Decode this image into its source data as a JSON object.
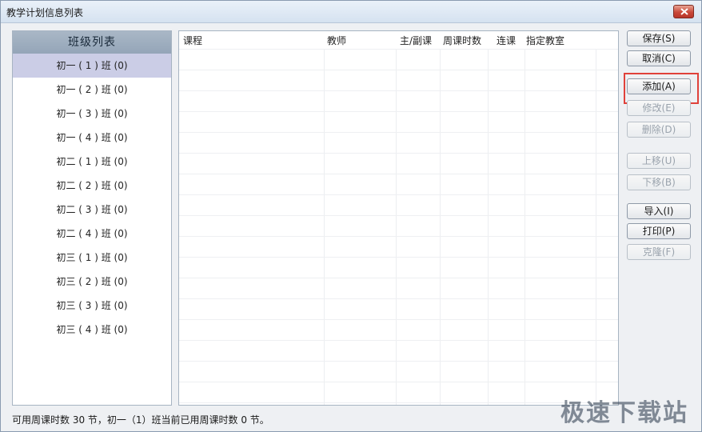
{
  "window": {
    "title": "教学计划信息列表"
  },
  "class_list": {
    "header": "班级列表",
    "items": [
      "初一 ( 1 ) 班 (0)",
      "初一 ( 2 ) 班 (0)",
      "初一 ( 3 ) 班 (0)",
      "初一 ( 4 ) 班 (0)",
      "初二 ( 1 ) 班 (0)",
      "初二 ( 2 ) 班 (0)",
      "初二 ( 3 ) 班 (0)",
      "初二 ( 4 ) 班 (0)",
      "初三 ( 1 ) 班 (0)",
      "初三 ( 2 ) 班 (0)",
      "初三 ( 3 ) 班 (0)",
      "初三 ( 4 ) 班 (0)"
    ],
    "selected_index": 0
  },
  "table": {
    "columns": [
      "课程",
      "教师",
      "主/副课",
      "周课时数",
      "连课",
      "指定教室"
    ],
    "rows": []
  },
  "buttons": {
    "save": "保存(S)",
    "cancel": "取消(C)",
    "add": "添加(A)",
    "edit": "修改(E)",
    "delete": "删除(D)",
    "move_up": "上移(U)",
    "move_down": "下移(B)",
    "import": "导入(I)",
    "print": "打印(P)",
    "clone": "克隆(F)"
  },
  "status_text": "可用周课时数 30 节，初一（1）班当前已用周课时数 0 节。",
  "watermark": "极速下载站",
  "colors": {
    "highlight": "#e0413a",
    "selected_row": "#cbcde6"
  }
}
